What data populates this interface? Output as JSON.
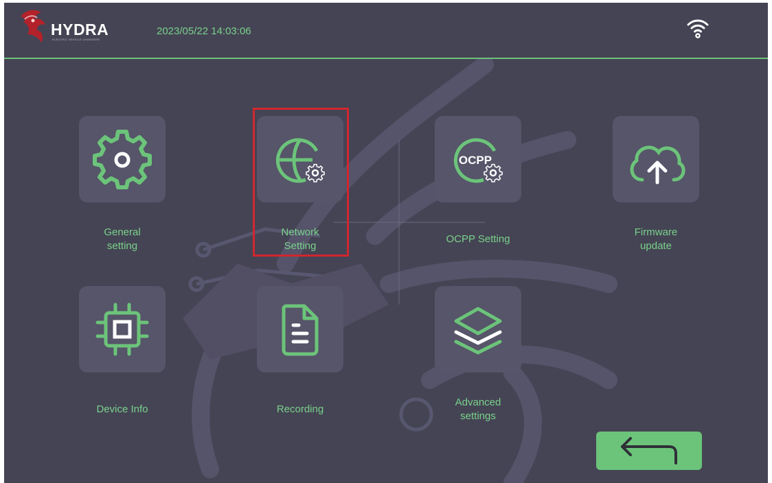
{
  "header": {
    "brand": "HYDRA",
    "tagline": "ELECTRIC VEHICLE CHARGERS",
    "datetime": "2023/05/22 14:03:06",
    "wifi_icon": "wifi-icon"
  },
  "menu": {
    "items": [
      {
        "label": "General\nsetting",
        "icon": "gear-icon"
      },
      {
        "label": "Network\nSetting",
        "icon": "globe-gear-icon",
        "selected": true
      },
      {
        "label": "OCPP Setting",
        "icon": "ocpp-gear-icon",
        "icon_text": "OCPP"
      },
      {
        "label": "Firmware\nupdate",
        "icon": "cloud-upload-icon"
      },
      {
        "label": "Device Info",
        "icon": "chip-icon"
      },
      {
        "label": "Recording",
        "icon": "document-icon"
      },
      {
        "label": "Advanced\nsettings",
        "icon": "layers-icon"
      }
    ]
  },
  "back_button": {
    "icon": "back-arrow-icon"
  },
  "colors": {
    "background": "#454454",
    "accent": "#6cc47a",
    "tile": "#565569",
    "highlight": "#d2262e",
    "text": "#79d28b"
  }
}
